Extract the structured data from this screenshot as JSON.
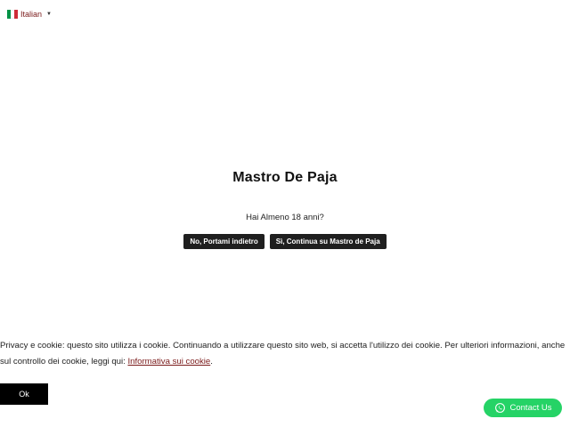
{
  "language": {
    "label": "Italian",
    "flag_colors": [
      "#009246",
      "#ffffff",
      "#ce2b37"
    ]
  },
  "age_gate": {
    "title": "Mastro De Paja",
    "question": "Hai Almeno 18 anni?",
    "no_button": "No, Portami indietro",
    "yes_button": "Sì, Continua su Mastro de Paja"
  },
  "cookie_banner": {
    "text": "Privacy e cookie: questo sito utilizza i cookie. Continuando a utilizzare questo sito web, si accetta l'utilizzo dei cookie. Per ulteriori informazioni, anche sul controllo dei cookie, leggi qui: ",
    "link_text": "Informativa sui cookie",
    "trailing": ".",
    "ok_label": "Ok"
  },
  "contact": {
    "label": "Contact Us",
    "icon": "whatsapp-icon",
    "color": "#25d366"
  }
}
